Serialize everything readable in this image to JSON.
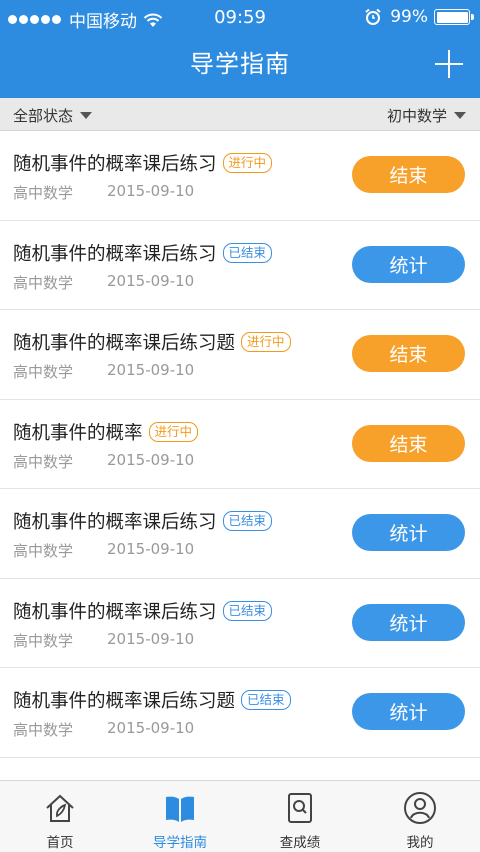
{
  "status_bar": {
    "carrier": "中国移动",
    "time": "09:59",
    "battery": "99%"
  },
  "nav": {
    "title": "导学指南",
    "add_icon": "plus-icon"
  },
  "filters": {
    "status_label": "全部状态",
    "subject_label": "初中数学"
  },
  "colors": {
    "primary": "#2e8ce0",
    "ongoing": "#f7a02a",
    "ended": "#3d97e8"
  },
  "items": [
    {
      "title": "随机事件的概率课后练习",
      "badge": "进行中",
      "state": "ongoing",
      "subject": "高中数学",
      "date": "2015-09-10",
      "action": "结束"
    },
    {
      "title": "随机事件的概率课后练习",
      "badge": "已结束",
      "state": "ended",
      "subject": "高中数学",
      "date": "2015-09-10",
      "action": "统计"
    },
    {
      "title": "随机事件的概率课后练习题",
      "badge": "进行中",
      "state": "ongoing",
      "subject": "高中数学",
      "date": "2015-09-10",
      "action": "结束"
    },
    {
      "title": "随机事件的概率",
      "badge": "进行中",
      "state": "ongoing",
      "subject": "高中数学",
      "date": "2015-09-10",
      "action": "结束"
    },
    {
      "title": "随机事件的概率课后练习",
      "badge": "已结束",
      "state": "ended",
      "subject": "高中数学",
      "date": "2015-09-10",
      "action": "统计"
    },
    {
      "title": "随机事件的概率课后练习",
      "badge": "已结束",
      "state": "ended",
      "subject": "高中数学",
      "date": "2015-09-10",
      "action": "统计"
    },
    {
      "title": "随机事件的概率课后练习题",
      "badge": "已结束",
      "state": "ended",
      "subject": "高中数学",
      "date": "2015-09-10",
      "action": "统计"
    }
  ],
  "tabs": [
    {
      "label": "首页",
      "icon": "home-icon",
      "active": false
    },
    {
      "label": "导学指南",
      "icon": "book-icon",
      "active": true
    },
    {
      "label": "查成绩",
      "icon": "search-document-icon",
      "active": false
    },
    {
      "label": "我的",
      "icon": "user-icon",
      "active": false
    }
  ]
}
